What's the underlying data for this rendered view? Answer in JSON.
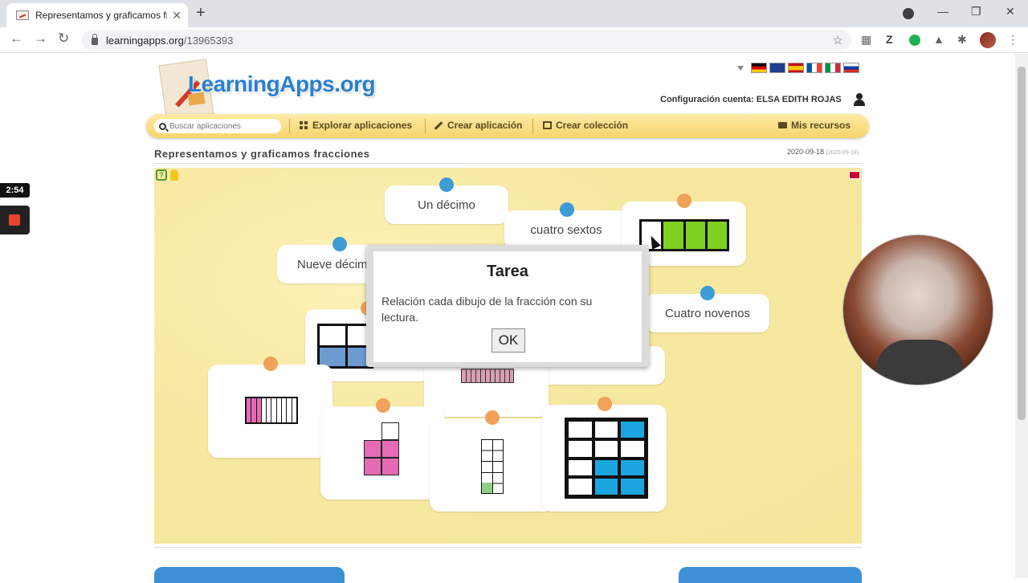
{
  "browser": {
    "tab_title": "Representamos y graficamos frac",
    "new_tab": "+",
    "url_host": "learningapps.org",
    "url_path": "/13965393",
    "minimize": "—",
    "restore": "❐",
    "close": "✕"
  },
  "site": {
    "logo_text": "LearningApps.org",
    "account_label": "Configuración cuenta: ELSA EDITH ROJAS",
    "search_placeholder": "Buscar aplicaciones",
    "menu": {
      "explore": "Explorar aplicaciones",
      "create_app": "Crear aplicación",
      "create_collection": "Crear colección",
      "my_resources": "Mis recursos"
    },
    "flags": [
      "#d8a21d",
      "#3a5fb3",
      "#d5241d",
      "#3f68c2",
      "#1a9e46",
      "#3a59b4"
    ]
  },
  "app": {
    "title": "Representamos y graficamos fracciones",
    "date": "2020-09-18",
    "date_small": "(2020-09-18)",
    "cards": {
      "un_decimo": "Un décimo",
      "cuatro_sextos": "cuatro sextos",
      "nueve_decimos": "Nueve décim",
      "cuatro_novenos": "Cuatro novenos"
    }
  },
  "modal": {
    "title": "Tarea",
    "text": "Relación cada dibujo de la fracción con su lectura.",
    "ok": "OK"
  },
  "recording": {
    "timer": "2:54"
  }
}
